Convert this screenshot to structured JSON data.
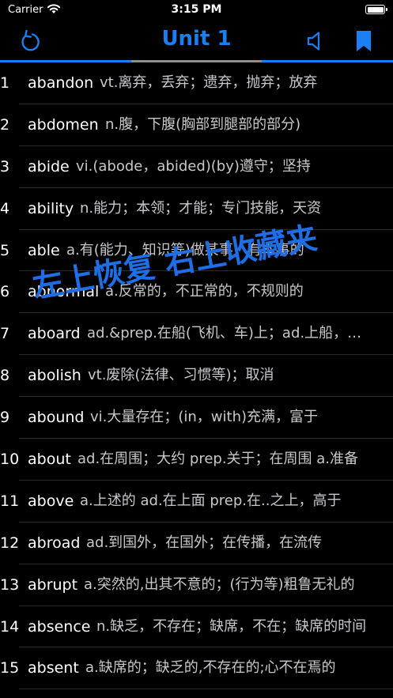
{
  "status": {
    "carrier": "Carrier",
    "time": "3:15 PM"
  },
  "header": {
    "title": "Unit 1"
  },
  "icons": {
    "refresh": "refresh-icon",
    "speaker": "speaker-icon",
    "bookmark": "bookmark-icon"
  },
  "colors": {
    "accent": "#1a7ff2",
    "progress_track": "#8e8e93",
    "overlay_text": "#1e6fe6"
  },
  "words": [
    {
      "num": "1",
      "word": "abandon",
      "def": "vt.离弃，丢弃；遗弃，抛弃；放弃"
    },
    {
      "num": "2",
      "word": "abdomen",
      "def": "n.腹，下腹(胸部到腿部的部分)"
    },
    {
      "num": "3",
      "word": "abide",
      "def": "vi.(abode，abided)(by)遵守；坚持"
    },
    {
      "num": "4",
      "word": "ability",
      "def": "n.能力；本领；才能；专门技能，天资"
    },
    {
      "num": "5",
      "word": "able",
      "def": "a.有(能力、知识等)做某事，有本事的"
    },
    {
      "num": "6",
      "word": "abnormal",
      "def": "a.反常的，不正常的，不规则的"
    },
    {
      "num": "7",
      "word": "aboard",
      "def": "ad.&prep.在船(飞机、车)上；ad.上船，上飞机"
    },
    {
      "num": "8",
      "word": "abolish",
      "def": "vt.废除(法律、习惯等)；取消"
    },
    {
      "num": "9",
      "word": "abound",
      "def": "vi.大量存在；(in，with)充满，富于"
    },
    {
      "num": "10",
      "word": "about",
      "def": "ad.在周围；大约 prep.关于；在周围 a.准备"
    },
    {
      "num": "11",
      "word": "above",
      "def": "a.上述的 ad.在上面  prep.在..之上，高于"
    },
    {
      "num": "12",
      "word": "abroad",
      "def": "ad.到国外，在国外；在传播，在流传"
    },
    {
      "num": "13",
      "word": "abrupt",
      "def": "a.突然的,出其不意的；(行为等)粗鲁无礼的"
    },
    {
      "num": "14",
      "word": "absence",
      "def": "n.缺乏，不存在；缺席，不在；缺席的时间"
    },
    {
      "num": "15",
      "word": "absent",
      "def": "a.缺席的；缺乏的,不存在的;心不在焉的"
    }
  ],
  "overlay": {
    "text": "左上恢复 右上收藏夹"
  }
}
